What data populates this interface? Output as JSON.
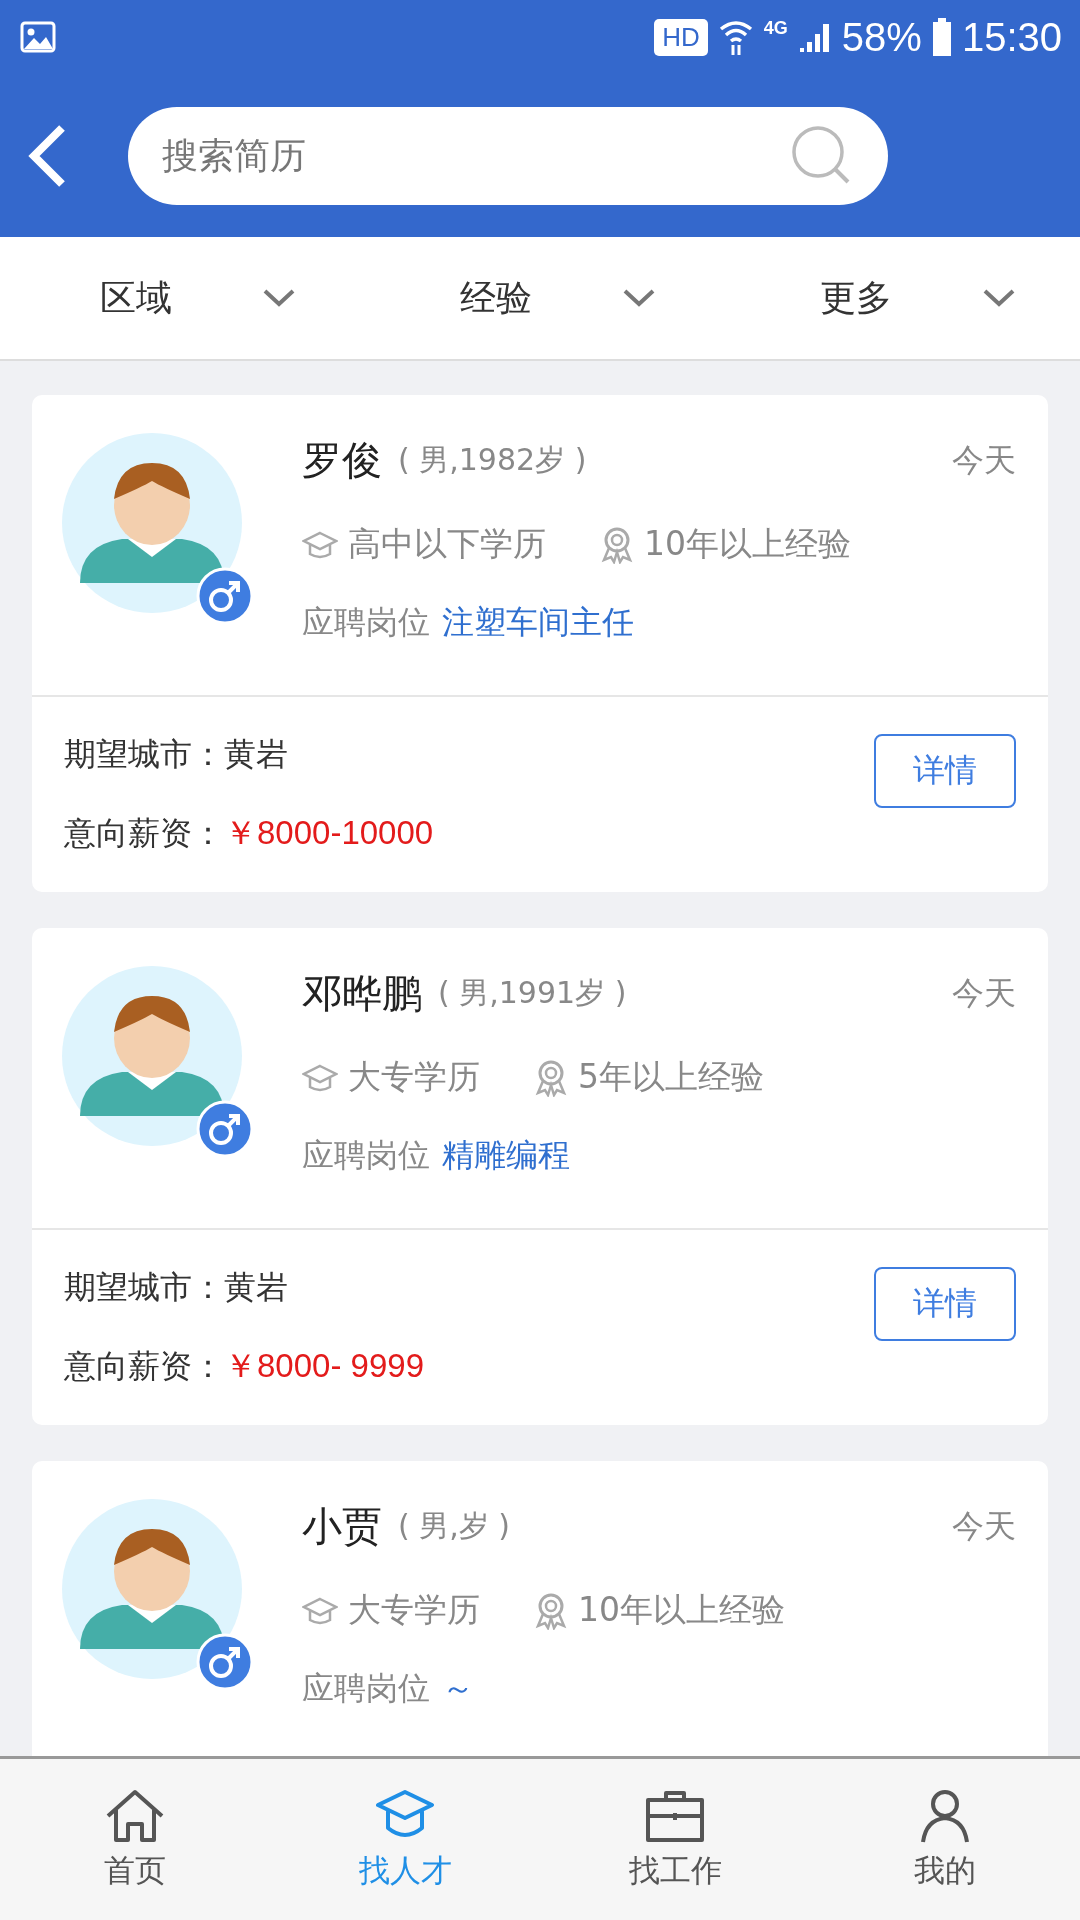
{
  "status_bar": {
    "hd": "HD",
    "network": "4G",
    "battery": "58%",
    "time": "15:30"
  },
  "search": {
    "placeholder": "搜索简历"
  },
  "filters": [
    {
      "label": "区域"
    },
    {
      "label": "经验"
    },
    {
      "label": "更多"
    }
  ],
  "resumes": [
    {
      "name": "罗俊",
      "info": "( 男,1982岁 )",
      "date": "今天",
      "kind": "male",
      "education": "高中以下学历",
      "experience": "10年以上经验",
      "position_label": "应聘岗位",
      "position": "注塑车间主任",
      "city_label": "期望城市：",
      "city": "黄岩",
      "salary_label": "意向薪资：",
      "salary": "￥8000-10000",
      "button": "详情"
    },
    {
      "name": "邓晔鹏",
      "info": "( 男,1991岁 )",
      "date": "今天",
      "kind": "male",
      "education": "大专学历",
      "experience": "5年以上经验",
      "position_label": "应聘岗位",
      "position": "精雕编程",
      "city_label": "期望城市：",
      "city": "黄岩",
      "salary_label": "意向薪资：",
      "salary": "￥8000- 9999",
      "button": "详情"
    },
    {
      "name": "小贾",
      "info": "( 男,岁 )",
      "date": "今天",
      "kind": "male",
      "education": "大专学历",
      "experience": "10年以上经验",
      "position_label": "应聘岗位",
      "position": "～"
    }
  ],
  "nav": [
    {
      "label": "首页",
      "selected": false
    },
    {
      "label": "找人才",
      "selected": true
    },
    {
      "label": "找工作",
      "selected": false
    },
    {
      "label": "我的",
      "selected": false
    }
  ]
}
